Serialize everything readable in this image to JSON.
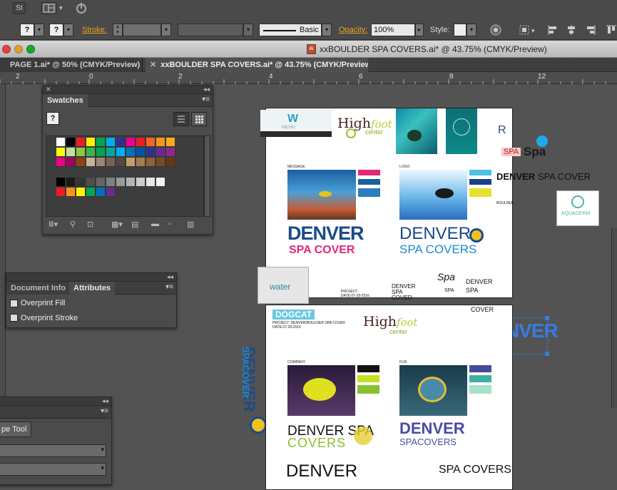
{
  "controlbar": {
    "stroke_label": "Stroke:",
    "brush_value": "Basic",
    "opacity_label": "Opacity:",
    "opacity_value": "100%",
    "style_label": "Style:",
    "workspace_icon": "St"
  },
  "window": {
    "title": "xxBOULDER SPA COVERS.ai* @ 43.75% (CMYK/Preview)"
  },
  "tabs": [
    {
      "label": "PAGE 1.ai* @ 50% (CMYK/Preview)"
    },
    {
      "label": "xxBOULDER SPA COVERS.ai* @ 43.75% (CMYK/Preview)"
    }
  ],
  "ruler": {
    "ticks": [
      "2",
      "0",
      "2",
      "4",
      "6",
      "8",
      "10",
      "12"
    ]
  },
  "swatches_panel": {
    "title": "Swatches",
    "colors": [
      "#ffffff",
      "#000000",
      "#ee1d23",
      "#fff200",
      "#00a650",
      "#00aeef",
      "#2e3192",
      "#ec008c",
      "#ed1c24",
      "#f26522",
      "#f7941d",
      "#fbad18",
      "#ffff00",
      "#c4df9b",
      "#8dc63f",
      "#39b54a",
      "#00a651",
      "#00a99d",
      "#00aeef",
      "#0072bc",
      "#0054a6",
      "#2e3192",
      "#662d91",
      "#92278f",
      "#ec008c",
      "#a3005c",
      "#8b4513",
      "#c7b299",
      "#998675",
      "#736357",
      "#534741",
      "#c69c6d",
      "#a67c52",
      "#8c6239",
      "#754c24",
      "#603913"
    ],
    "grays": [
      "#000000",
      "#1a1a1a",
      "#333333",
      "#4d4d4d",
      "#666666",
      "#808080",
      "#999999",
      "#b3b3b3",
      "#cccccc",
      "#e6e6e6",
      "#f2f2f2"
    ],
    "brights": [
      "#ed1c24",
      "#f7941d",
      "#fff200",
      "#00a651",
      "#0072bc",
      "#662d91"
    ]
  },
  "attributes_panel": {
    "tab_docinfo": "Document Info",
    "tab_attributes": "Attributes",
    "overprint_fill": "Overprint Fill",
    "overprint_stroke": "Overprint Stroke"
  },
  "tool_panel": {
    "button_label": "pe Tool"
  },
  "artwork": {
    "nichu": "NICHU",
    "highfoot": "High",
    "highfoot_center": "center",
    "spa": "Spa",
    "spa_box": "SPA",
    "denver_spa_cover_line1": "DENVER",
    "denver_spa_cover_line2": "SPA COVER",
    "aquaderm": "AQUADERM",
    "boulder": "BOULDER",
    "message_label": "MESSAGE",
    "logo_label": "LOGO",
    "denver_big": "DENVER",
    "spacover_big": "SPA COVER",
    "denver_covers": "DENVER",
    "spa_covers": "SPA COVERS",
    "water": "water",
    "projects": "PROJECT:",
    "date": "DATE:07-29-2016",
    "denver_spa_cover_small": "DENVER",
    "spa_small": "SPA",
    "cover_small": "COVER",
    "denver_right": "DENVER",
    "spa_right": "SPA",
    "dogcat": "DOGCAT",
    "project2": "PROJECT: DENVER/BOULDER SPA COVER",
    "date2": "DATE:07-29-2016",
    "cover_top": "COVER",
    "company_label": "COMPANY",
    "fun_label": "FUN",
    "denver_spa": "DENVER SPA",
    "covers": "COVERS",
    "denver3": "DENVER",
    "spacovers3": "SPACOVERS",
    "denver4": "DENVER",
    "spa_covers4": "SPA COVERS",
    "vert_denver": "DENVER",
    "vert_spacover": "SPACOVER"
  }
}
